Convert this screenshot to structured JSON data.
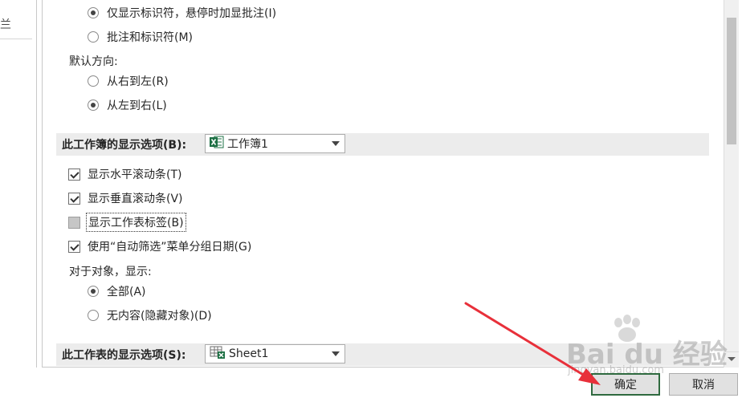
{
  "left_nav": {
    "fragment": "兰"
  },
  "display_group": {
    "opt_indicator_only": {
      "label": "仅显示标识符，悬停时加显批注(I)",
      "checked": true
    },
    "opt_comments_and_indicators": {
      "label": "批注和标识符(M)",
      "checked": false
    }
  },
  "direction": {
    "heading": "默认方向:",
    "right_to_left": {
      "label": "从右到左(R)",
      "checked": false
    },
    "left_to_right": {
      "label": "从左到右(L)",
      "checked": true
    }
  },
  "workbook_section": {
    "title": "此工作簿的显示选项(B):",
    "combo_value": "工作簿1",
    "options": {
      "horizontal_scroll": {
        "label": "显示水平滚动条(T)",
        "checked": true
      },
      "vertical_scroll": {
        "label": "显示垂直滚动条(V)",
        "checked": true
      },
      "sheet_tabs": {
        "label": "显示工作表标签(B)",
        "checked": "indeterminate"
      },
      "autofilter_group_dates": {
        "label": "使用“自动筛选”菜单分组日期(G)",
        "checked": true
      }
    },
    "objects_heading": "对于对象，显示:",
    "objects_all": {
      "label": "全部(A)",
      "checked": true
    },
    "objects_none": {
      "label": "无内容(隐藏对象)(D)",
      "checked": false
    }
  },
  "worksheet_section": {
    "title": "此工作表的显示选项(S):",
    "combo_value": "Sheet1"
  },
  "footer": {
    "ok_label": "确定",
    "cancel_label": "取消"
  },
  "watermark": {
    "brand": "Bai du 经验",
    "url": "jingyan.baidu.com"
  },
  "colors": {
    "annotation_arrow": "#e8303a",
    "ok_border": "#2f6a3f",
    "excel_green": "#1d7044"
  }
}
